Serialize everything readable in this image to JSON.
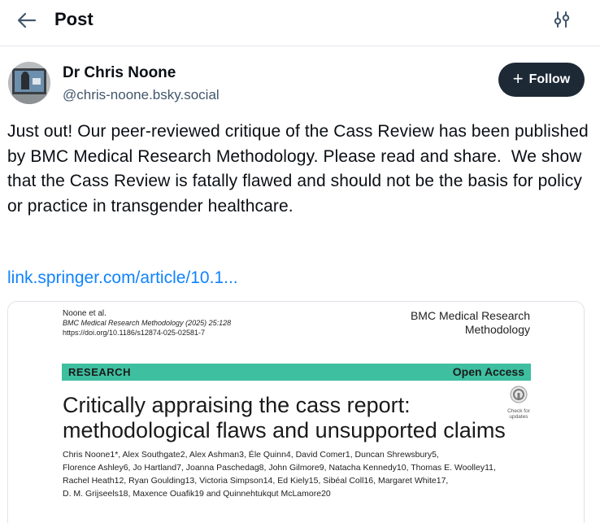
{
  "header": {
    "title": "Post"
  },
  "author": {
    "name": "Dr Chris Noone",
    "handle": "@chris-noone.bsky.social",
    "follow_label": "Follow"
  },
  "post": {
    "text": "Just out! Our peer-reviewed critique of the Cass Review has been published by BMC Medical Research Methodology. Please read and share.  We show that the Cass Review is fatally flawed and should not be the basis for policy or practice in transgender healthcare.",
    "link_text": "link.springer.com/article/10.1..."
  },
  "image": {
    "meta_line1": "Noone et al.",
    "meta_line2": "BMC Medical Research Methodology (2025) 25:128",
    "meta_line3": "https://doi.org/10.1186/s12874-025-02581-7",
    "journal_line1": "BMC Medical Research",
    "journal_line2": "Methodology",
    "section_label": "RESEARCH",
    "access_label": "Open Access",
    "title_line1": "Critically appraising the cass report:",
    "title_line2": "methodological flaws and unsupported claims",
    "check_label": "Check for updates",
    "authors_line1": "Chris Noone1*, Alex Southgate2, Alex Ashman3, Éle Quinn4, David Comer1, Duncan Shrewsbury5,",
    "authors_line2": "Florence Ashley6, Jo Hartland7, Joanna Paschedag8, John Gilmore9, Natacha Kennedy10, Thomas E. Woolley11,",
    "authors_line3": "Rachel Heath12, Ryan Goulding13, Victoria Simpson14, Ed Kiely15, Sibéal Coll16, Margaret White17,",
    "authors_line4": "D. M. Grijseels18, Maxence Ouafik19 and Quinnehtukqut McLamore20"
  },
  "icons": {
    "back": "arrow-left-icon",
    "settings": "sliders-icon",
    "follow": "plus-icon",
    "check_updates": "check-for-updates-icon"
  },
  "colors": {
    "follow_bg": "#1e2936",
    "link": "#1083fe",
    "handle": "#42576c",
    "research_bar": "#3ebfa0"
  }
}
